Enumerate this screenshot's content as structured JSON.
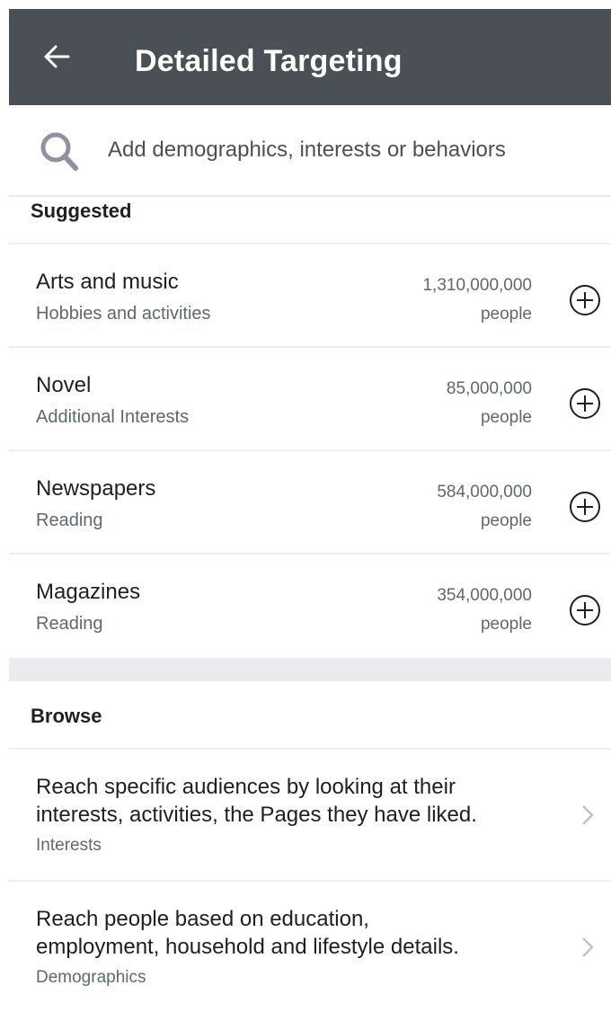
{
  "header": {
    "title": "Detailed Targeting"
  },
  "search": {
    "placeholder": "Add demographics, interests or behaviors"
  },
  "suggested": {
    "title": "Suggested",
    "items": [
      {
        "name": "Arts and music",
        "category": "Hobbies and activities",
        "count": "1,310,000,000",
        "unit": "people"
      },
      {
        "name": "Novel",
        "category": "Additional Interests",
        "count": "85,000,000",
        "unit": "people"
      },
      {
        "name": "Newspapers",
        "category": "Reading",
        "count": "584,000,000",
        "unit": "people"
      },
      {
        "name": "Magazines",
        "category": "Reading",
        "count": "354,000,000",
        "unit": "people"
      }
    ]
  },
  "browse": {
    "title": "Browse",
    "items": [
      {
        "line1": "Reach specific audiences by looking at their",
        "line2": "interests, activities, the Pages they have liked.",
        "category": "Interests"
      },
      {
        "line1": "Reach people based on education,",
        "line2": "employment, household and lifestyle details.",
        "category": "Demographics"
      }
    ]
  },
  "colors": {
    "header_bg": "#4b4f56",
    "secondary_text": "#606770",
    "divider": "#e9ebee"
  }
}
